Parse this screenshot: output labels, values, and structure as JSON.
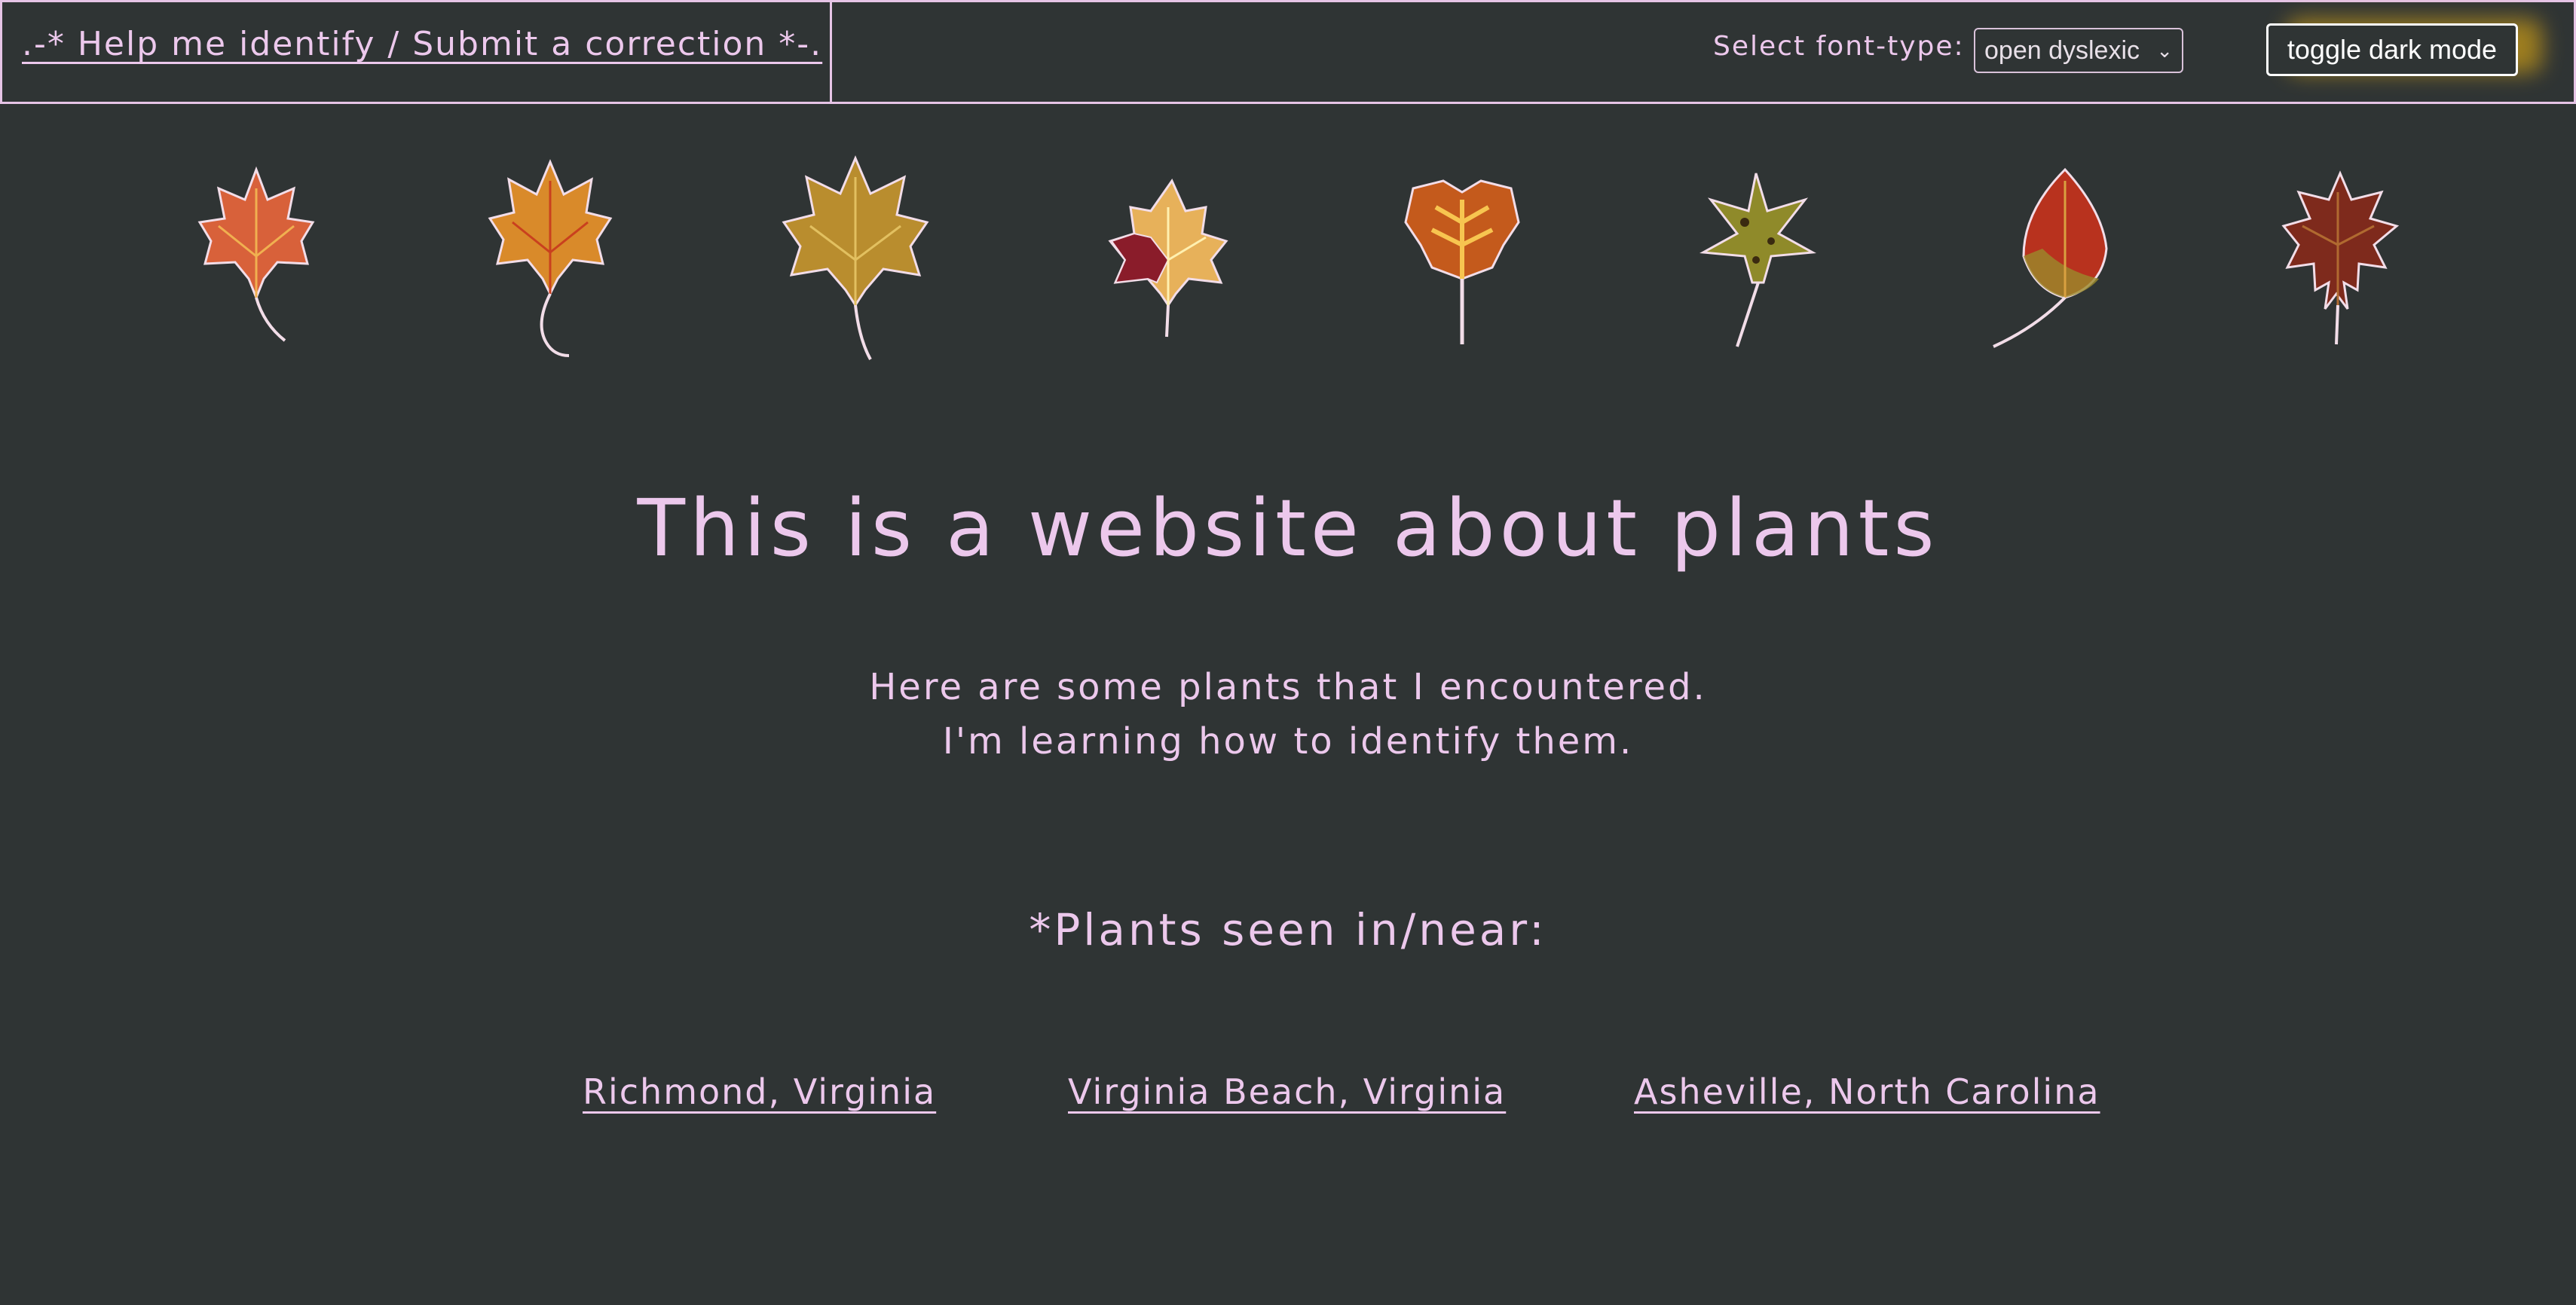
{
  "header": {
    "help_link": ".-* Help me identify / Submit a correction *-.",
    "font_label": "Select font-type:",
    "font_select_value": "open dyslexic",
    "toggle_label": "toggle dark mode"
  },
  "leaves": [
    {
      "name": "red-maple-leaf-icon",
      "color": "#d8613a",
      "vein": "#f0b050"
    },
    {
      "name": "sugar-maple-leaf-icon",
      "color": "#d98a2a",
      "vein": "#f5c25a"
    },
    {
      "name": "large-maple-leaf-icon",
      "color": "#b98d2e",
      "vein": "#e2c060"
    },
    {
      "name": "sycamore-leaf-icon",
      "color": "#e7b15a",
      "vein": "#fff0b0"
    },
    {
      "name": "tulip-poplar-leaf-icon",
      "color": "#c45a1c",
      "vein": "#f7c550"
    },
    {
      "name": "sweetgum-leaf-icon",
      "color": "#8f8a2a",
      "vein": "#c9b860"
    },
    {
      "name": "gum-leaf-icon",
      "color": "#b8321e",
      "vein": "#d9a040"
    },
    {
      "name": "oak-leaf-icon",
      "color": "#7e2a1c",
      "vein": "#b06a30"
    }
  ],
  "main": {
    "title": "This is a website about plants",
    "intro_line1": "Here are some plants that I encountered.",
    "intro_line2": "I'm learning how to identify them.",
    "seen_heading": "*Plants seen in/near:",
    "locations": [
      "Richmond, Virginia",
      "Virginia Beach, Virginia",
      "Asheville, North Carolina"
    ]
  }
}
